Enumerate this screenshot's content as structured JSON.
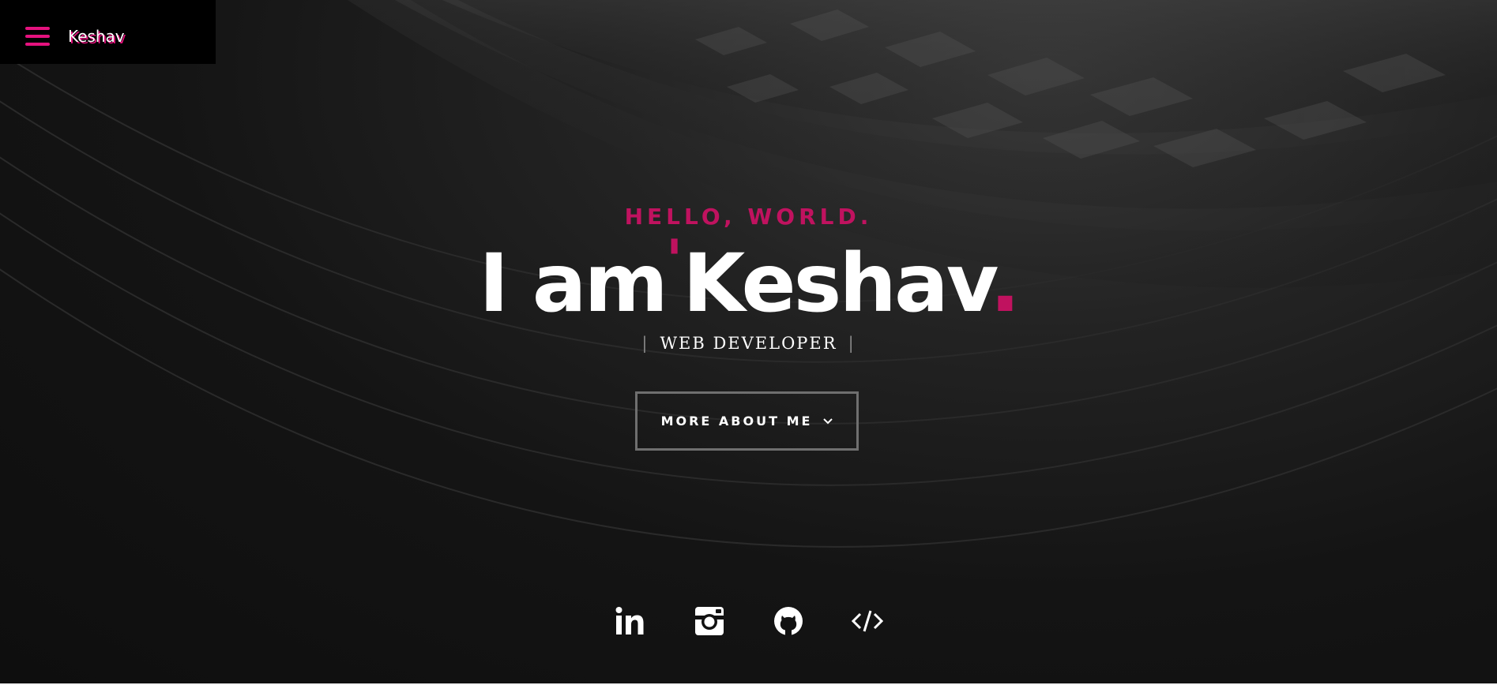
{
  "header": {
    "brand": "Keshav",
    "menu_icon": "hamburger-icon"
  },
  "intro": {
    "greeting": "HELLO, WORLD.",
    "headline_prefix": "I am",
    "headline_apostrophe": "'",
    "headline_name": "Keshav",
    "headline_dot": ".",
    "role_bar_left": "|",
    "role": "WEB DEVELOPER",
    "role_bar_right": "|",
    "more_button_label": "MORE ABOUT ME"
  },
  "social": [
    {
      "name": "linkedin",
      "icon": "linkedin-icon"
    },
    {
      "name": "instagram",
      "icon": "instagram-icon"
    },
    {
      "name": "github",
      "icon": "github-icon"
    },
    {
      "name": "code",
      "icon": "code-icon"
    }
  ],
  "colors": {
    "accent": "#c0125f",
    "menu_accent": "#e5127e",
    "background": "#111111"
  }
}
